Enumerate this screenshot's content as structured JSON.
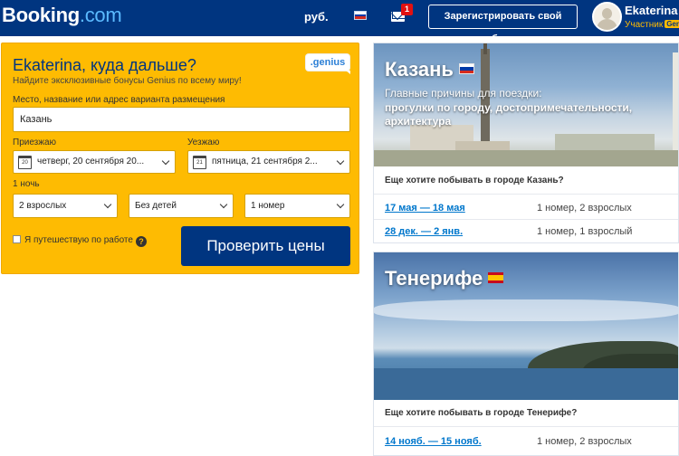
{
  "header": {
    "logo_main": "Booking",
    "logo_domain": ".com",
    "currency": "руб.",
    "messages_count": "1",
    "register_property": "Зарегистрировать свой объект",
    "user_name": "Ekaterina",
    "user_level": "Участник",
    "user_badge": "Gen"
  },
  "search": {
    "title": "Ekaterina, куда дальше?",
    "subtitle": "Найдите эксклюзивные бонусы Genius по всему миру!",
    "genius_badge": ".genius",
    "destination_label": "Место, название или адрес варианта размещения",
    "destination_value": "Казань",
    "checkin_label": "Приезжаю",
    "checkin_day": "20",
    "checkin_value": "четверг, 20 сентября 20...",
    "checkout_label": "Уезжаю",
    "checkout_day": "21",
    "checkout_value": "пятница, 21 сентября 2...",
    "nights": "1 ночь",
    "adults": "2 взрослых",
    "children": "Без детей",
    "rooms": "1 номер",
    "business_label": "Я путешествую по работе",
    "help": "?",
    "submit_label": "Проверить цены"
  },
  "cards": [
    {
      "city": "Казань",
      "reasons_label": "Главные причины для поездки:",
      "reasons": "прогулки по городу, достопримечательности, архитектура",
      "visit_question": "Еще хотите побывать в городе Казань?",
      "trips": [
        {
          "dates": "17 мая — 18 мая",
          "rooms": "1 номер, 2 взрослых"
        },
        {
          "dates": "28 дек. — 2 янв.",
          "rooms": "1 номер, 1 взрослый"
        }
      ]
    },
    {
      "city": "Тенерифе",
      "visit_question": "Еще хотите побывать в городе Тенерифе?",
      "trips": [
        {
          "dates": "14 нояб. — 15 нояб.",
          "rooms": "1 номер, 2 взрослых"
        }
      ]
    }
  ],
  "colors": {
    "header_bg": "#003580",
    "search_bg": "#febb02",
    "button_bg": "#003580",
    "link": "#0077cc"
  }
}
